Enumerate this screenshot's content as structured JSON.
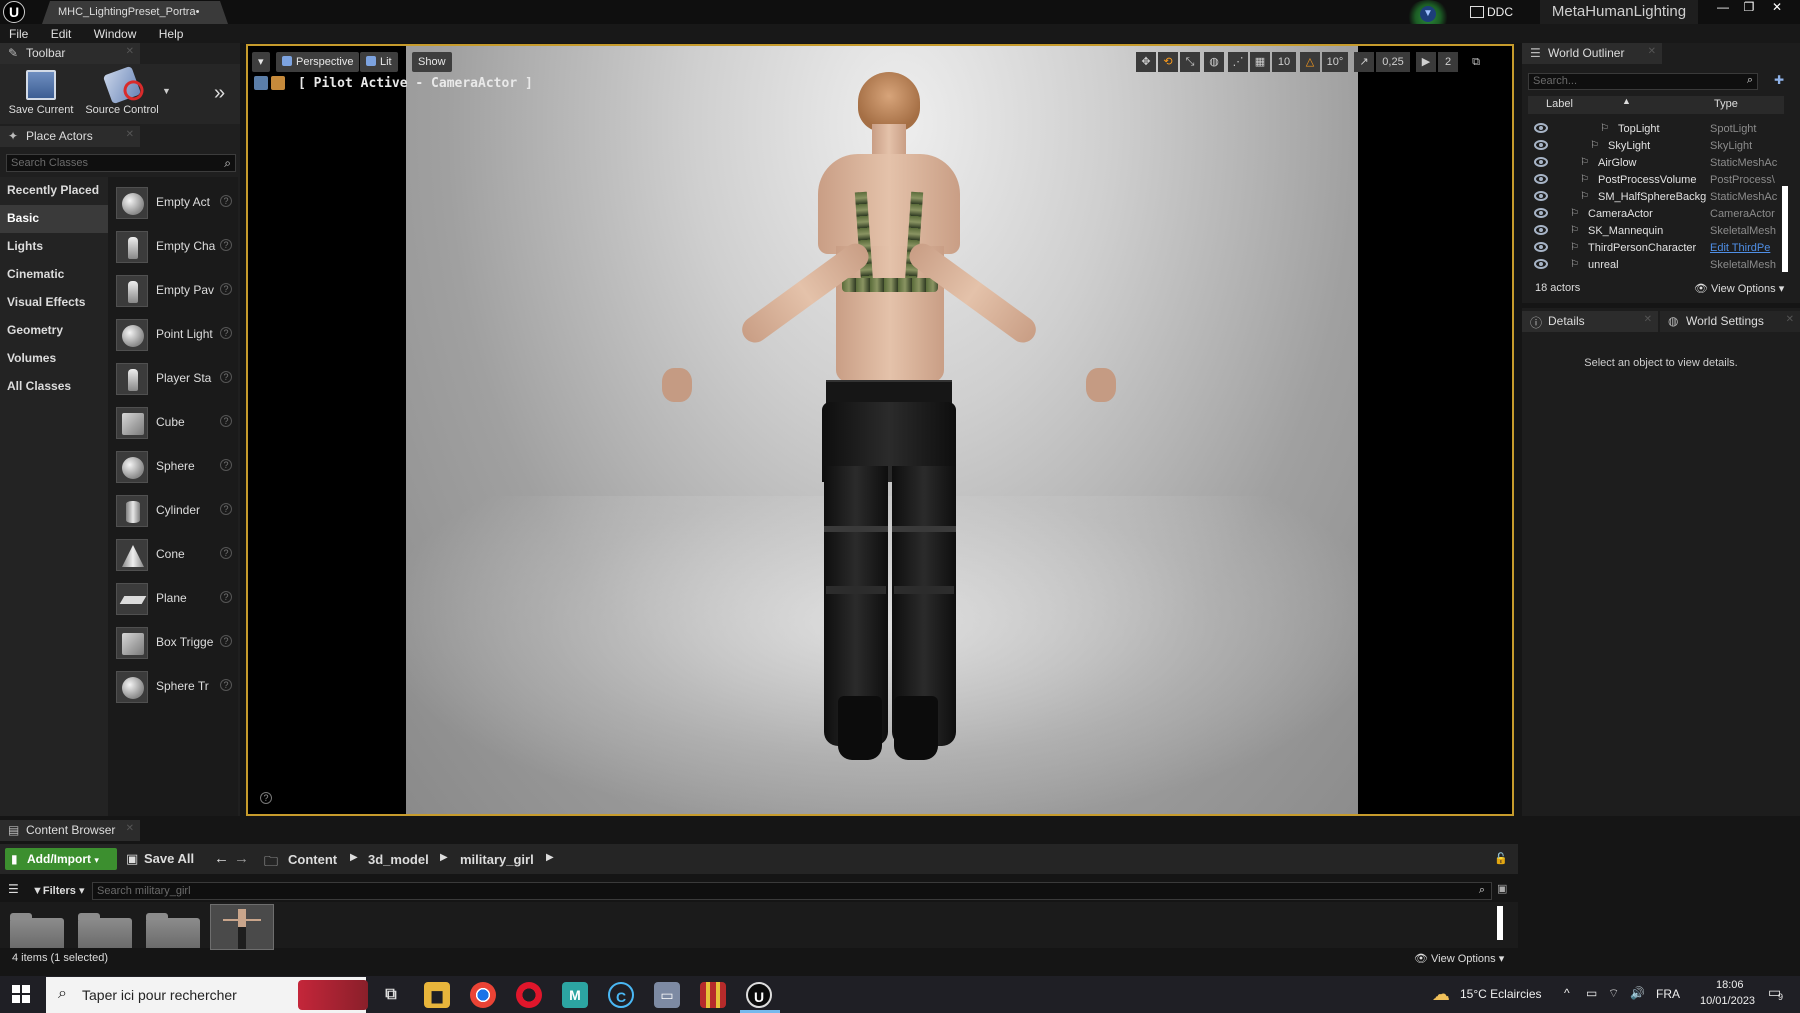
{
  "window": {
    "doc_tab": "MHC_LightingPreset_Portra•",
    "ddc_label": "DDC",
    "project": "MetaHumanLighting",
    "controls": [
      "—",
      "❐",
      "✕"
    ]
  },
  "menu": [
    "File",
    "Edit",
    "Window",
    "Help"
  ],
  "toolbar": {
    "tab_label": "Toolbar",
    "save_label": "Save Current",
    "source_label": "Source Control"
  },
  "place_actors": {
    "tab_label": "Place Actors",
    "search_placeholder": "Search Classes",
    "categories": [
      "Recently Placed",
      "Basic",
      "Lights",
      "Cinematic",
      "Visual Effects",
      "Geometry",
      "Volumes",
      "All Classes"
    ],
    "items": [
      {
        "label": "Empty Act",
        "shape": "sphere"
      },
      {
        "label": "Empty Cha",
        "shape": "fig"
      },
      {
        "label": "Empty Pav",
        "shape": "fig"
      },
      {
        "label": "Point Light",
        "shape": "sphere"
      },
      {
        "label": "Player Sta",
        "shape": "fig"
      },
      {
        "label": "Cube",
        "shape": "cube"
      },
      {
        "label": "Sphere",
        "shape": "sphere"
      },
      {
        "label": "Cylinder",
        "shape": "cyl"
      },
      {
        "label": "Cone",
        "shape": "cone"
      },
      {
        "label": "Plane",
        "shape": "plane"
      },
      {
        "label": "Box Trigge",
        "shape": "cube"
      },
      {
        "label": "Sphere Tr",
        "shape": "sphere"
      }
    ]
  },
  "viewport": {
    "perspective": "Perspective",
    "lit": "Lit",
    "show": "Show",
    "grid_snap": "10",
    "rot_snap": "10°",
    "scale_snap": "0,25",
    "cam_speed": "2",
    "pilot_label": "[ Pilot Active - CameraActor ]"
  },
  "outliner": {
    "tab_label": "World Outliner",
    "search_placeholder": "Search...",
    "col_label": "Label",
    "col_type": "Type",
    "rows": [
      {
        "name": "TopLight",
        "type": "SpotLight",
        "indent": 90
      },
      {
        "name": "SkyLight",
        "type": "SkyLight",
        "indent": 80
      },
      {
        "name": "AirGlow",
        "type": "StaticMeshAc",
        "indent": 70
      },
      {
        "name": "PostProcessVolume",
        "type": "PostProcess\\",
        "indent": 70
      },
      {
        "name": "SM_HalfSphereBackg",
        "type": "StaticMeshAc",
        "indent": 70
      },
      {
        "name": "CameraActor",
        "type": "CameraActor",
        "indent": 60
      },
      {
        "name": "SK_Mannequin",
        "type": "SkeletalMesh",
        "indent": 60
      },
      {
        "name": "ThirdPersonCharacter",
        "type": "Edit ThirdPe",
        "indent": 60,
        "link": true
      },
      {
        "name": "unreal",
        "type": "SkeletalMesh",
        "indent": 60
      }
    ],
    "actor_count": "18 actors",
    "view_options": "View Options"
  },
  "details": {
    "tab_label": "Details",
    "world_settings": "World Settings",
    "empty_text": "Select an object to view details."
  },
  "content_browser": {
    "tab_label": "Content Browser",
    "add_import": "Add/Import",
    "save_all": "Save All",
    "breadcrumb": [
      "Content",
      "3d_model",
      "military_girl"
    ],
    "filters": "Filters",
    "search_placeholder": "Search military_girl",
    "items_count": "4 items (1 selected)",
    "view_options": "View Options"
  },
  "taskbar": {
    "search_text": "Taper ici pour rechercher",
    "weather": "15°C  Eclaircies",
    "lang": "FRA",
    "time": "18:06",
    "date": "10/01/2023",
    "notif_count": "9"
  }
}
